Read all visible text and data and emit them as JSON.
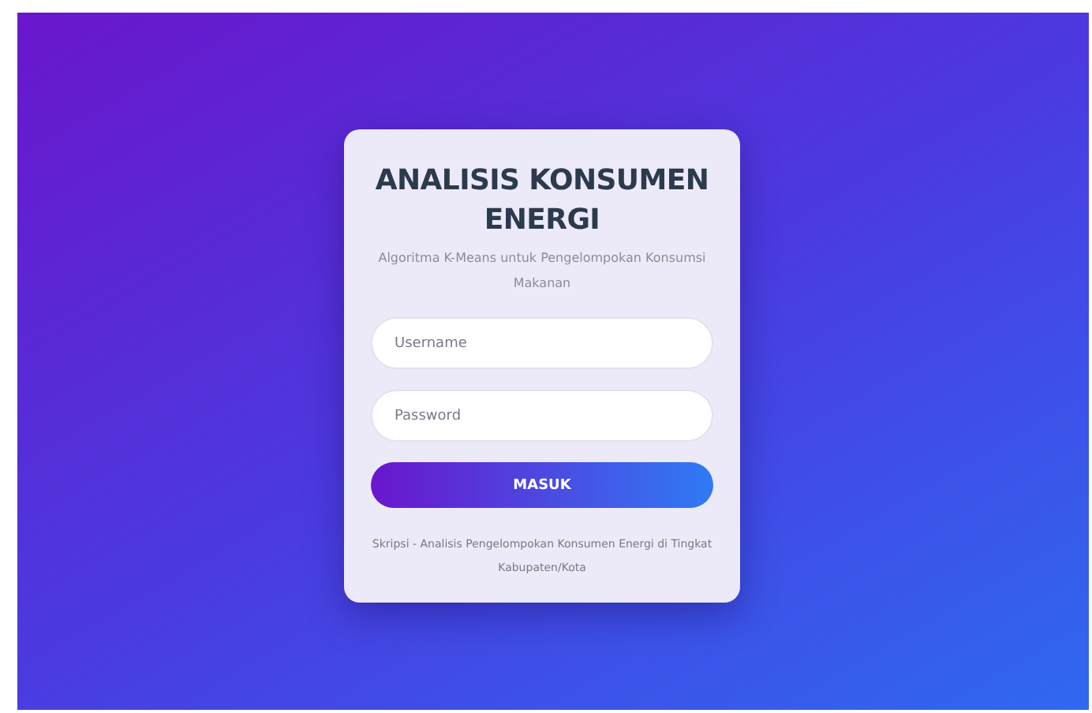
{
  "title": "ANALISIS KONSUMEN ENERGI",
  "subtitle": "Algoritma K-Means untuk Pengelompokan Konsumsi Makanan",
  "fields": [
    {
      "placeholder": "Username"
    },
    {
      "placeholder": "Password"
    }
  ],
  "button": "MASUK",
  "footer": "Skripsi - Analisis Pengelompokan Konsumen Energi di Tingkat Kabupaten/Kota"
}
